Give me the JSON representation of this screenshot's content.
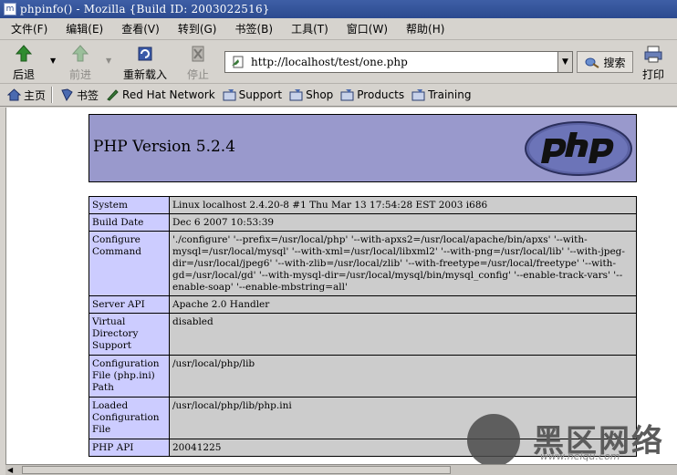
{
  "window": {
    "title": "phpinfo() - Mozilla {Build ID: 2003022516}"
  },
  "menu": [
    "文件(F)",
    "编辑(E)",
    "查看(V)",
    "转到(G)",
    "书签(B)",
    "工具(T)",
    "窗口(W)",
    "帮助(H)"
  ],
  "nav": {
    "back": "后退",
    "forward": "前进",
    "reload": "重新载入",
    "stop": "停止",
    "url": "http://localhost/test/one.php",
    "search": "搜索",
    "print": "打印"
  },
  "personal": {
    "home": "主页",
    "bookmarks": "书签",
    "links": [
      "Red Hat Network",
      "Support",
      "Shop",
      "Products",
      "Training"
    ]
  },
  "page": {
    "version": "PHP Version 5.2.4",
    "rows": [
      {
        "key": "System",
        "value": "Linux localhost 2.4.20-8 #1 Thu Mar 13 17:54:28 EST 2003 i686"
      },
      {
        "key": "Build Date",
        "value": "Dec 6 2007 10:53:39"
      },
      {
        "key": "Configure Command",
        "value": "'./configure' '--prefix=/usr/local/php' '--with-apxs2=/usr/local/apache/bin/apxs' '--with-mysql=/usr/local/mysql' '--with-xml=/usr/local/libxml2' '--with-png=/usr/local/lib' '--with-jpeg-dir=/usr/local/jpeg6' '--with-zlib=/usr/local/zlib' '--with-freetype=/usr/local/freetype' '--with-gd=/usr/local/gd' '--with-mysql-dir=/usr/local/mysql/bin/mysql_config' '--enable-track-vars' '--enable-soap' '--enable-mbstring=all'"
      },
      {
        "key": "Server API",
        "value": "Apache 2.0 Handler"
      },
      {
        "key": "Virtual Directory Support",
        "value": "disabled"
      },
      {
        "key": "Configuration File (php.ini) Path",
        "value": "/usr/local/php/lib"
      },
      {
        "key": "Loaded Configuration File",
        "value": "/usr/local/php/lib/php.ini"
      },
      {
        "key": "PHP API",
        "value": "20041225"
      }
    ]
  },
  "watermark": {
    "text": "黑区网络",
    "url": "www.heiqu.com"
  }
}
